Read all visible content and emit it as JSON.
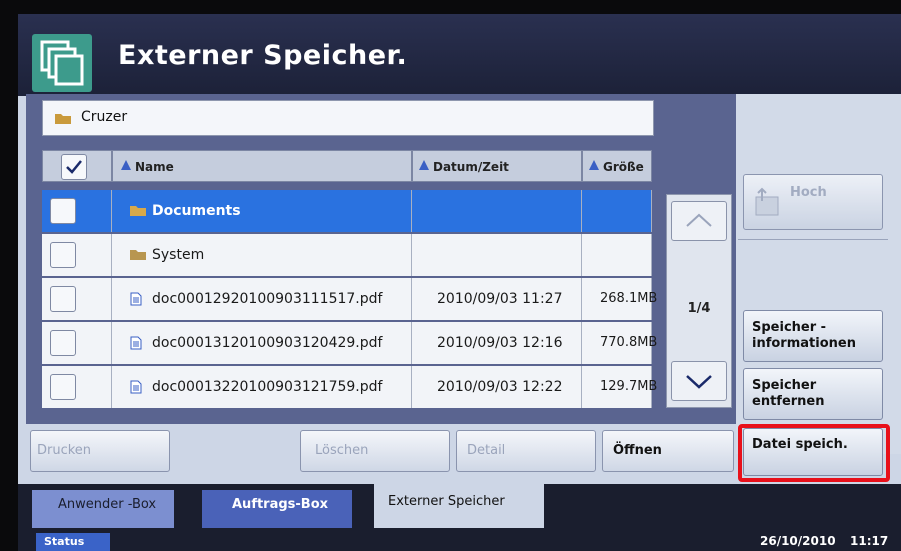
{
  "title": "Externer Speicher.",
  "path": {
    "folder_icon": "folder-icon",
    "label": "Cruzer"
  },
  "columns": {
    "name": "Name",
    "date": "Datum/Zeit",
    "size": "Größe"
  },
  "rows": [
    {
      "name": "Documents",
      "date": "",
      "size": "",
      "type": "folder",
      "selected": true
    },
    {
      "name": "System",
      "date": "",
      "size": "",
      "type": "folder",
      "selected": false
    },
    {
      "name": "doc00012920100903111517.pdf",
      "date": "2010/09/03 11:27",
      "size": "268.1MB",
      "type": "file",
      "selected": false
    },
    {
      "name": "doc00013120100903120429.pdf",
      "date": "2010/09/03 12:16",
      "size": "770.8MB",
      "type": "file",
      "selected": false
    },
    {
      "name": "doc00013220100903121759.pdf",
      "date": "2010/09/03 12:22",
      "size": "129.7MB",
      "type": "file",
      "selected": false
    }
  ],
  "pager": {
    "page": "1/4"
  },
  "side": {
    "up": "Hoch",
    "info_line1": "Speicher -",
    "info_line2": "informationen",
    "remove_line1": "Speicher",
    "remove_line2": "entfernen",
    "save": "Datei speich."
  },
  "actions": {
    "print": "Drucken",
    "delete": "Löschen",
    "detail": "Detail",
    "open": "Öffnen"
  },
  "tabs": {
    "user_box": "Anwender -Box",
    "job_box": "Auftrags-Box",
    "external": "Externer Speicher"
  },
  "status": {
    "label": "Status",
    "date": "26/10/2010",
    "time": "11:17"
  },
  "colors": {
    "selected_row": "#2a72e0",
    "highlight": "#e8101a",
    "title_bar": "#1c2138"
  }
}
